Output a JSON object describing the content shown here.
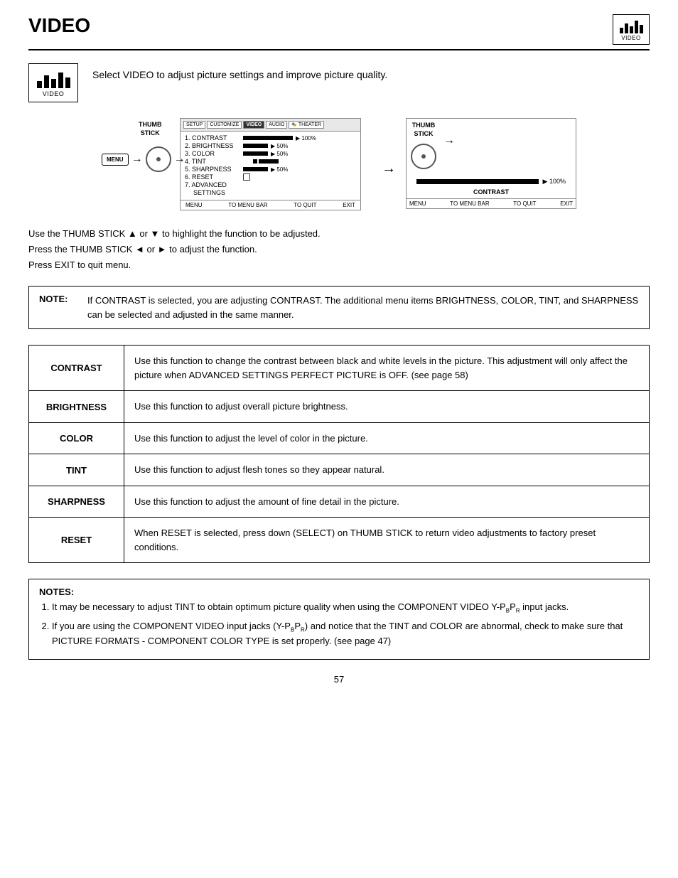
{
  "header": {
    "title": "VIDEO",
    "icon_label": "VIDEO",
    "icon_bars": [
      8,
      14,
      10,
      18,
      12
    ]
  },
  "intro": {
    "text": "Select VIDEO to adjust picture settings and improve picture quality.",
    "icon_label": "VIDEO",
    "icon_bars": [
      10,
      18,
      13,
      22,
      15
    ]
  },
  "diagram": {
    "left": {
      "thumb_label_line1": "THUMB",
      "thumb_label_line2": "STICK",
      "menu_tabs": [
        "SETUP",
        "CUSTOMIZE",
        "VIDEO",
        "AUDIO",
        "THEATER"
      ],
      "menu_items": [
        {
          "num": "1.",
          "label": "CONTRAST",
          "bar_pct": 100,
          "value": "100%"
        },
        {
          "num": "2.",
          "label": "BRIGHTNESS",
          "bar_pct": 50,
          "value": "50%"
        },
        {
          "num": "3.",
          "label": "COLOR",
          "bar_pct": 50,
          "value": "50%"
        },
        {
          "num": "4.",
          "label": "TINT",
          "bar_pct": 50,
          "value": ""
        },
        {
          "num": "5.",
          "label": "SHARPNESS",
          "bar_pct": 50,
          "value": "50%"
        },
        {
          "num": "6.",
          "label": "RESET",
          "has_checkbox": true
        },
        {
          "num": "7.",
          "label": "ADVANCED",
          "sub_label": "SETTINGS"
        }
      ],
      "footer_items": [
        "MENU",
        "TO MENU BAR",
        "TO QUIT",
        "EXIT"
      ]
    },
    "right": {
      "thumb_label_line1": "THUMB",
      "thumb_label_line2": "STICK",
      "bar_value": "▶ 100%",
      "bar_label": "CONTRAST",
      "footer_items": [
        "MENU",
        "TO MENU BAR",
        "TO QUIT",
        "EXIT"
      ]
    }
  },
  "instructions": [
    "Use the THUMB STICK ▲ or ▼ to highlight the function to be adjusted.",
    "Press the THUMB STICK ◄ or ► to adjust the function.",
    "Press EXIT to quit menu."
  ],
  "note": {
    "label": "NOTE:",
    "text": "If CONTRAST is selected, you are adjusting CONTRAST.  The additional menu items BRIGHTNESS, COLOR, TINT, and SHARPNESS can be selected and adjusted in the same manner."
  },
  "functions": [
    {
      "label": "CONTRAST",
      "desc": "Use this function to change the contrast between black and white levels in the picture.  This adjustment will only affect the picture when ADVANCED SETTINGS PERFECT PICTURE is OFF. (see page 58)"
    },
    {
      "label": "BRIGHTNESS",
      "desc": "Use this function to adjust overall picture brightness."
    },
    {
      "label": "COLOR",
      "desc": "Use this function to adjust the level of color in the picture."
    },
    {
      "label": "TINT",
      "desc": "Use this function to adjust flesh tones so they appear natural."
    },
    {
      "label": "SHARPNESS",
      "desc": "Use this function to adjust the amount of fine detail in the picture."
    },
    {
      "label": "RESET",
      "desc": "When RESET is selected, press down (SELECT) on THUMB STICK to return video adjustments to factory preset conditions."
    }
  ],
  "notes_bottom": {
    "label": "NOTES:",
    "items": [
      "It may be necessary to adjust TINT to obtain optimum picture quality when using the COMPONENT VIDEO Y-P<sub>B</sub>P<sub>R</sub> input jacks.",
      "If you are using the COMPONENT VIDEO input jacks (Y-P<sub>B</sub>P<sub>R</sub>) and notice that the TINT and COLOR are abnormal, check to make sure that PICTURE FORMATS - COMPONENT COLOR TYPE is set properly. (see page 47)"
    ]
  },
  "page_number": "57"
}
